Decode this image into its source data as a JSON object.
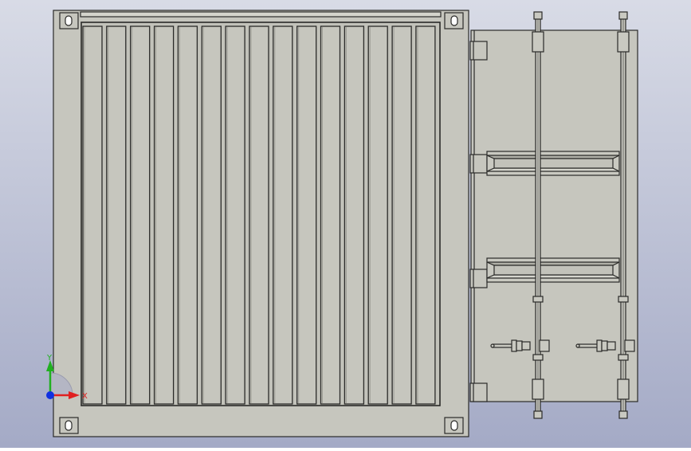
{
  "colors": {
    "background_top": "#d8dbe6",
    "background_bottom": "#a4aac6",
    "panel_face": "#c6c6be",
    "panel_light": "#d4d4cc",
    "outline": "#2a2a28",
    "bar_shadow": "#9c9c94",
    "axis_x": "#e02020",
    "axis_y": "#20b020",
    "axis_z": "#1030e0"
  },
  "triad": {
    "x_label": "X",
    "y_label": "Y"
  }
}
